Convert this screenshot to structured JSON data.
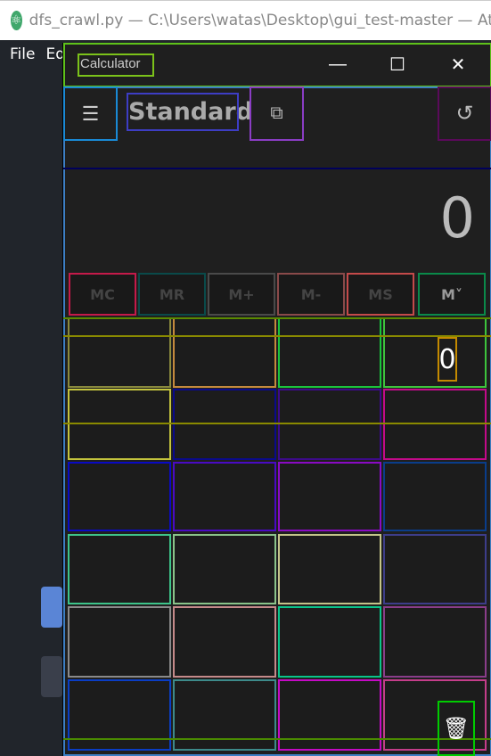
{
  "atom": {
    "window_title": "dfs_crawl.py — C:\\Users\\watas\\Desktop\\gui_test-master — Atom",
    "menu": [
      "File",
      "Edit"
    ]
  },
  "calculator": {
    "title": "Calculator",
    "mode": "Standard",
    "display": "0",
    "memory_buttons": [
      "MC",
      "MR",
      "M+",
      "M-",
      "MS",
      "M˅"
    ],
    "memory_list_value": "0",
    "window_controls": {
      "minimize": "—",
      "maximize": "☐",
      "close": "✕"
    },
    "icons": {
      "menu": "☰",
      "keep_on_top": "⧉",
      "history": "↺",
      "trash": "🗑"
    }
  }
}
